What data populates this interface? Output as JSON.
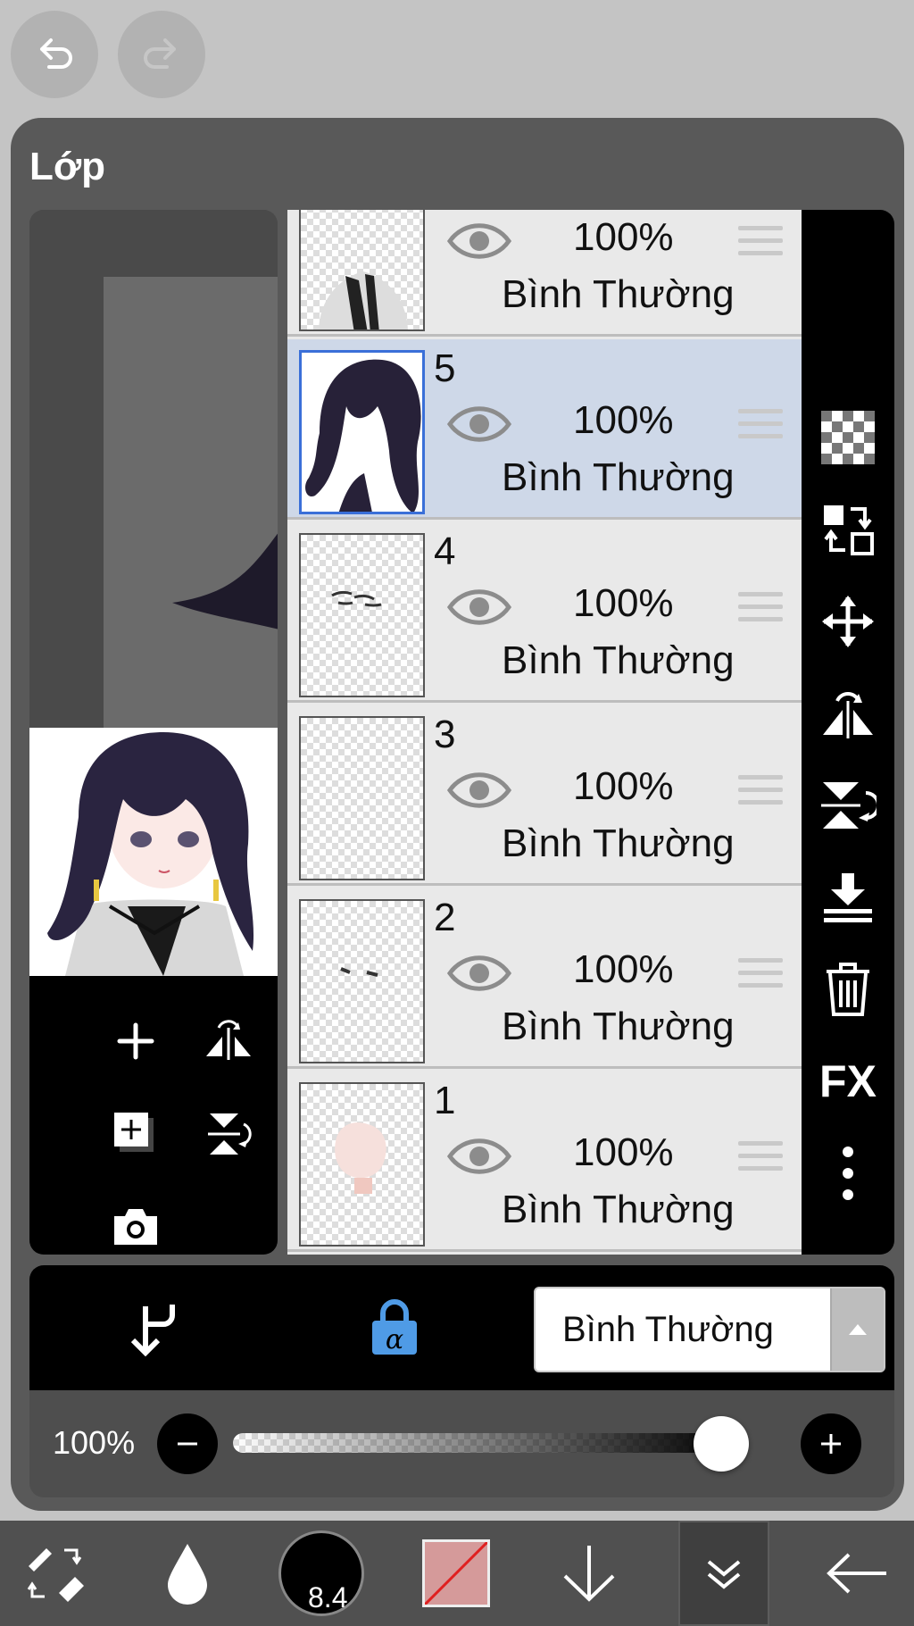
{
  "panel": {
    "title": "Lớp"
  },
  "layers": [
    {
      "number": "",
      "opacity": "100%",
      "blend": "Bình Thường",
      "selected": false
    },
    {
      "number": "5",
      "opacity": "100%",
      "blend": "Bình Thường",
      "selected": true
    },
    {
      "number": "4",
      "opacity": "100%",
      "blend": "Bình Thường",
      "selected": false
    },
    {
      "number": "3",
      "opacity": "100%",
      "blend": "Bình Thường",
      "selected": false
    },
    {
      "number": "2",
      "opacity": "100%",
      "blend": "Bình Thường",
      "selected": false
    },
    {
      "number": "1",
      "opacity": "100%",
      "blend": "Bình Thường",
      "selected": false
    }
  ],
  "right_tools": [
    "transparency-icon",
    "swap-layers-icon",
    "move-icon",
    "flip-horizontal-icon",
    "flip-vertical-icon",
    "merge-down-icon",
    "trash-icon",
    "fx-button",
    "more-icon"
  ],
  "right_tools_fx_label": "FX",
  "left_tools": [
    "add-layer-icon",
    "flip-horizontal-icon",
    "add-copy-layer-icon",
    "flip-vertical-icon",
    "camera-icon"
  ],
  "blend_bar": {
    "selected_mode": "Bình Thường"
  },
  "opacity_bar": {
    "label": "100%",
    "value": 1.0
  },
  "bottom_toolbar": {
    "brush_size": "8.4",
    "color": "#d59a9a"
  }
}
